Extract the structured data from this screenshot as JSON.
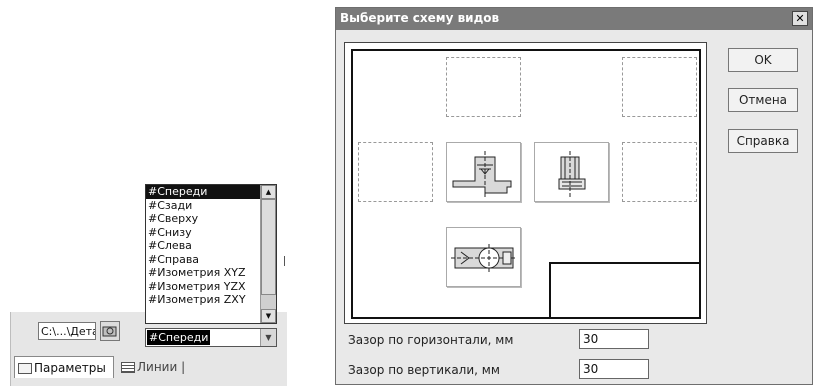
{
  "left_panel": {
    "path_value": "C:\\...\\Дета..",
    "combo_value": "#Спереди",
    "dropdown_items": [
      "#Спереди",
      "#Сзади",
      "#Сверху",
      "#Снизу",
      "#Слева",
      "#Справа",
      "#Изометрия XYZ",
      "#Изометрия YZX",
      "#Изометрия ZXY"
    ],
    "selected_index": 0,
    "tabs": [
      {
        "label": "Параметры",
        "icon": "parameters-icon"
      },
      {
        "label": "Линии",
        "icon": "lines-icon"
      }
    ]
  },
  "dialog": {
    "title": "Выберите схему видов",
    "buttons": {
      "ok": "OK",
      "cancel": "Отмена",
      "help": "Справка"
    },
    "fields": [
      {
        "label": "Зазор по горизонтали, мм",
        "value": "30"
      },
      {
        "label": "Зазор по вертикали, мм",
        "value": "30"
      }
    ],
    "views": {
      "front": "front-view-icon",
      "left": "left-view-icon",
      "top": "top-view-icon"
    }
  }
}
